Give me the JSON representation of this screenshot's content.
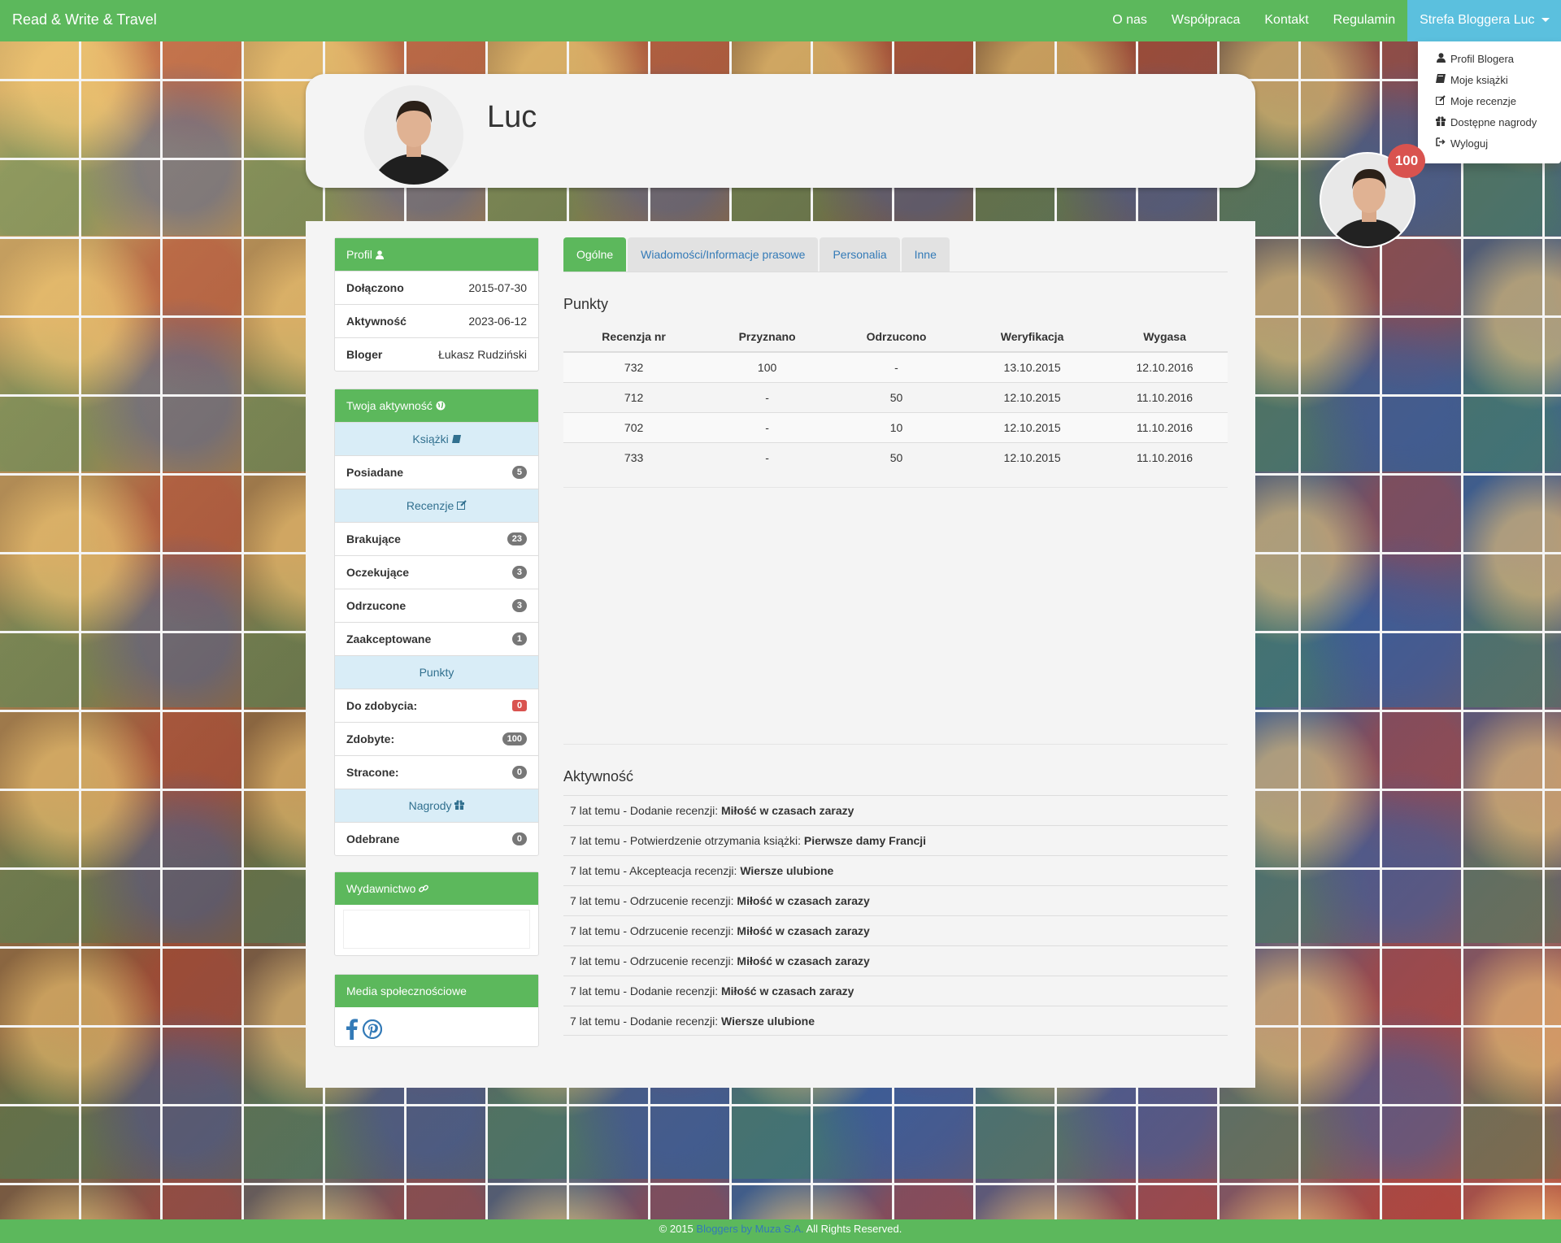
{
  "navbar": {
    "brand": "Read & Write & Travel",
    "links": [
      "O nas",
      "Współpraca",
      "Kontakt",
      "Regulamin"
    ],
    "user_menu": "Strefa Bloggera Luc"
  },
  "dropdown": {
    "items": [
      {
        "icon": "user-icon",
        "label": "Profil Blogera"
      },
      {
        "icon": "book-icon",
        "label": "Moje książki"
      },
      {
        "icon": "edit-icon",
        "label": "Moje recenzje"
      },
      {
        "icon": "gift-icon",
        "label": "Dostępne nagrody"
      },
      {
        "icon": "logout-icon",
        "label": "Wyloguj"
      }
    ]
  },
  "badge_points": "100",
  "profile": {
    "name": "Luc"
  },
  "panel_profil": {
    "title": "Profil",
    "rows": [
      {
        "key": "Dołączono",
        "value": "2015-07-30"
      },
      {
        "key": "Aktywność",
        "value": "2023-06-12"
      },
      {
        "key": "Bloger",
        "value": "Łukasz Rudziński"
      }
    ]
  },
  "panel_aktywnosc": {
    "title": "Twoja aktywność",
    "books_header": "Książki",
    "owned": {
      "label": "Posiadane",
      "count": "5"
    },
    "reviews_header": "Recenzje",
    "reviews": [
      {
        "label": "Brakujące",
        "count": "23"
      },
      {
        "label": "Oczekujące",
        "count": "3"
      },
      {
        "label": "Odrzucone",
        "count": "3"
      },
      {
        "label": "Zaakceptowane",
        "count": "1"
      }
    ],
    "points_header": "Punkty",
    "points": [
      {
        "label": "Do zdobycia:",
        "count": "0"
      },
      {
        "label": "Zdobyte:",
        "count": "100"
      },
      {
        "label": "Stracone:",
        "count": "0"
      }
    ],
    "awards_header": "Nagrody",
    "awards": {
      "label": "Odebrane",
      "count": "0"
    }
  },
  "panel_wydawnictwo": {
    "title": "Wydawnictwo"
  },
  "panel_media": {
    "title": "Media społecznościowe"
  },
  "tabs": [
    "Ogólne",
    "Wiadomości/Informacje prasowe",
    "Personalia",
    "Inne"
  ],
  "points_section": {
    "title": "Punkty",
    "columns": [
      "Recenzja nr",
      "Przyznano",
      "Odrzucono",
      "Weryfikacja",
      "Wygasa"
    ],
    "rows": [
      [
        "732",
        "100",
        "-",
        "13.10.2015",
        "12.10.2016"
      ],
      [
        "712",
        "-",
        "50",
        "12.10.2015",
        "11.10.2016"
      ],
      [
        "702",
        "-",
        "10",
        "12.10.2015",
        "11.10.2016"
      ],
      [
        "733",
        "-",
        "50",
        "12.10.2015",
        "11.10.2016"
      ]
    ]
  },
  "activity_section": {
    "title": "Aktywność",
    "items": [
      {
        "prefix": "7 lat temu - Dodanie recenzji: ",
        "title": "Miłość w czasach zarazy"
      },
      {
        "prefix": "7 lat temu - Potwierdzenie otrzymania książki: ",
        "title": "Pierwsze damy Francji"
      },
      {
        "prefix": "7 lat temu - Akcepteacja recenzji: ",
        "title": "Wiersze ulubione"
      },
      {
        "prefix": "7 lat temu - Odrzucenie recenzji: ",
        "title": "Miłość w czasach zarazy"
      },
      {
        "prefix": "7 lat temu - Odrzucenie recenzji: ",
        "title": "Miłość w czasach zarazy"
      },
      {
        "prefix": "7 lat temu - Odrzucenie recenzji: ",
        "title": "Miłość w czasach zarazy"
      },
      {
        "prefix": "7 lat temu - Dodanie recenzji: ",
        "title": "Miłość w czasach zarazy"
      },
      {
        "prefix": "7 lat temu - Dodanie recenzji: ",
        "title": "Wiersze ulubione"
      }
    ]
  },
  "footer": {
    "prefix": "© 2015 ",
    "link": "Bloggers by Muza S.A.",
    "suffix": " All Rights Reserved."
  },
  "colors": {
    "brand_green": "#5cb85c",
    "info_blue": "#5bc0de",
    "danger_red": "#d9534f"
  }
}
